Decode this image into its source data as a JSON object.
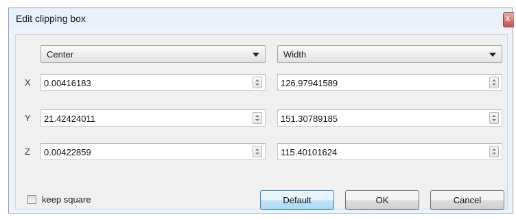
{
  "window": {
    "title": "Edit clipping box",
    "close_label": "x"
  },
  "left_mode": {
    "selected": "Center"
  },
  "right_mode": {
    "selected": "Width"
  },
  "rows": [
    {
      "axis": "X",
      "center": "0.00416183",
      "width": "126.97941589"
    },
    {
      "axis": "Y",
      "center": "21.42424011",
      "width": "151.30789185"
    },
    {
      "axis": "Z",
      "center": "0.00422859",
      "width": "115.40101624"
    }
  ],
  "options": {
    "keep_square_label": "keep square",
    "keep_square_checked": false
  },
  "buttons": {
    "default": "Default",
    "ok": "OK",
    "cancel": "Cancel"
  }
}
